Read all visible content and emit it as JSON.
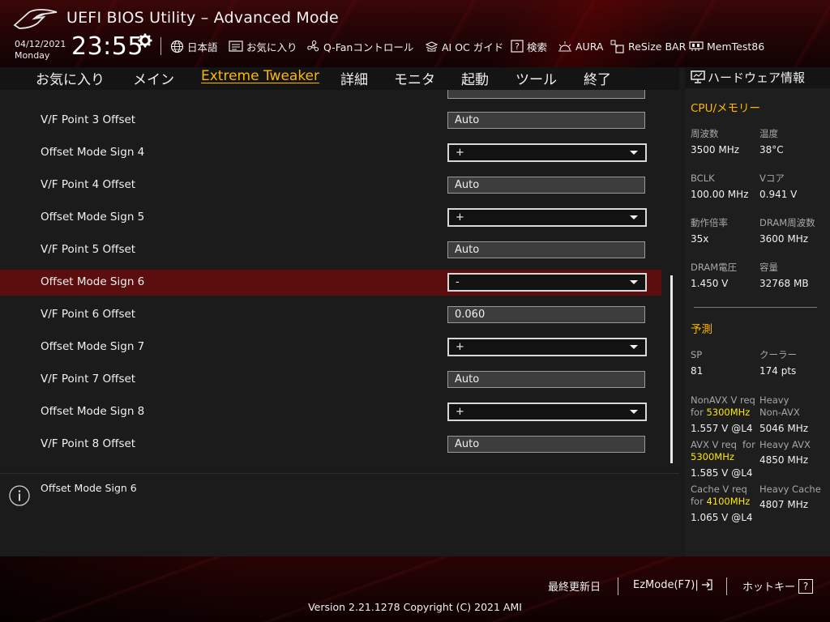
{
  "header": {
    "title": "UEFI BIOS Utility – Advanced Mode",
    "date": "04/12/2021",
    "weekday": "Monday",
    "time": "23:55",
    "tools": [
      {
        "label": "日本語",
        "icon": "globe-icon"
      },
      {
        "label": "お気に入り",
        "icon": "favorites-icon"
      },
      {
        "label": "Q-Fanコントロール",
        "icon": "fan-icon"
      },
      {
        "label": "AI OC ガイド",
        "icon": "ai-oc-icon"
      },
      {
        "label": "検索",
        "icon": "help-search-icon"
      },
      {
        "label": "AURA",
        "icon": "aura-icon"
      },
      {
        "label": "ReSize BAR",
        "icon": "resize-bar-icon"
      },
      {
        "label": "MemTest86",
        "icon": "memtest-icon"
      }
    ]
  },
  "tabs": [
    {
      "label": "お気に入り"
    },
    {
      "label": "メイン"
    },
    {
      "label": "Extreme Tweaker",
      "active": true
    },
    {
      "label": "詳細"
    },
    {
      "label": "モニタ"
    },
    {
      "label": "起動"
    },
    {
      "label": "ツール"
    },
    {
      "label": "終了"
    }
  ],
  "settings": [
    {
      "label": "V/F Point 3 Offset",
      "value": "Auto",
      "type": "field"
    },
    {
      "label": "Offset Mode Sign 4",
      "value": "+",
      "type": "select"
    },
    {
      "label": "V/F Point 4 Offset",
      "value": "Auto",
      "type": "field"
    },
    {
      "label": "Offset Mode Sign 5",
      "value": "+",
      "type": "select"
    },
    {
      "label": "V/F Point 5 Offset",
      "value": "Auto",
      "type": "field"
    },
    {
      "label": "Offset Mode Sign 6",
      "value": "-",
      "type": "select",
      "selected": true
    },
    {
      "label": "V/F Point 6 Offset",
      "value": "0.060",
      "type": "field"
    },
    {
      "label": "Offset Mode Sign 7",
      "value": "+",
      "type": "select"
    },
    {
      "label": "V/F Point 7 Offset",
      "value": "Auto",
      "type": "field"
    },
    {
      "label": "Offset Mode Sign 8",
      "value": "+",
      "type": "select"
    },
    {
      "label": "V/F Point 8 Offset",
      "value": "Auto",
      "type": "field"
    }
  ],
  "description": {
    "text": "Offset Mode Sign 6"
  },
  "hardware": {
    "title": "ハードウェア情報",
    "cpu_section": "CPU/メモリー",
    "cpu": [
      {
        "label": "周波数",
        "value": "3500 MHz"
      },
      {
        "label": "温度",
        "value": "38°C"
      },
      {
        "label": "BCLK",
        "value": "100.00 MHz"
      },
      {
        "label": "Vコア",
        "value": "0.941 V"
      },
      {
        "label": "動作倍率",
        "value": "35x"
      },
      {
        "label": "DRAM周波数",
        "value": "3600 MHz"
      },
      {
        "label": "DRAM電圧",
        "value": "1.450 V"
      },
      {
        "label": "容量",
        "value": "32768 MB"
      }
    ],
    "prediction_section": "予測",
    "sp": {
      "label": "SP",
      "value": "81"
    },
    "cooler": {
      "label": "クーラー",
      "value": "174 pts"
    },
    "nonavx": {
      "label": "NonAVX V req",
      "for": "for",
      "freq": "5300MHz",
      "value": "1.557 V @L4"
    },
    "heavy_nonavx": {
      "label1": "Heavy",
      "label2": "Non-AVX",
      "value": "5046 MHz"
    },
    "avx": {
      "label": "AVX V req",
      "for": "for",
      "freq": "5300MHz",
      "value": "1.585 V @L4"
    },
    "heavy_avx": {
      "label": "Heavy AVX",
      "value": "4850 MHz"
    },
    "cache": {
      "label": "Cache V req",
      "for": "for",
      "freq": "4100MHz",
      "value": "1.065 V @L4"
    },
    "heavy_cache": {
      "label": "Heavy Cache",
      "value": "4807 MHz"
    }
  },
  "footer": {
    "last_modified": "最終更新日",
    "ezmode": "EzMode(F7)|",
    "hotkeys": "ホットキー",
    "hotkey_glyph": "?",
    "version": "Version 2.21.1278 Copyright (C) 2021 AMI"
  },
  "colors": {
    "accent": "#ffb600",
    "highlight": "#ffe600",
    "selected_row": "#5c0d0d"
  }
}
